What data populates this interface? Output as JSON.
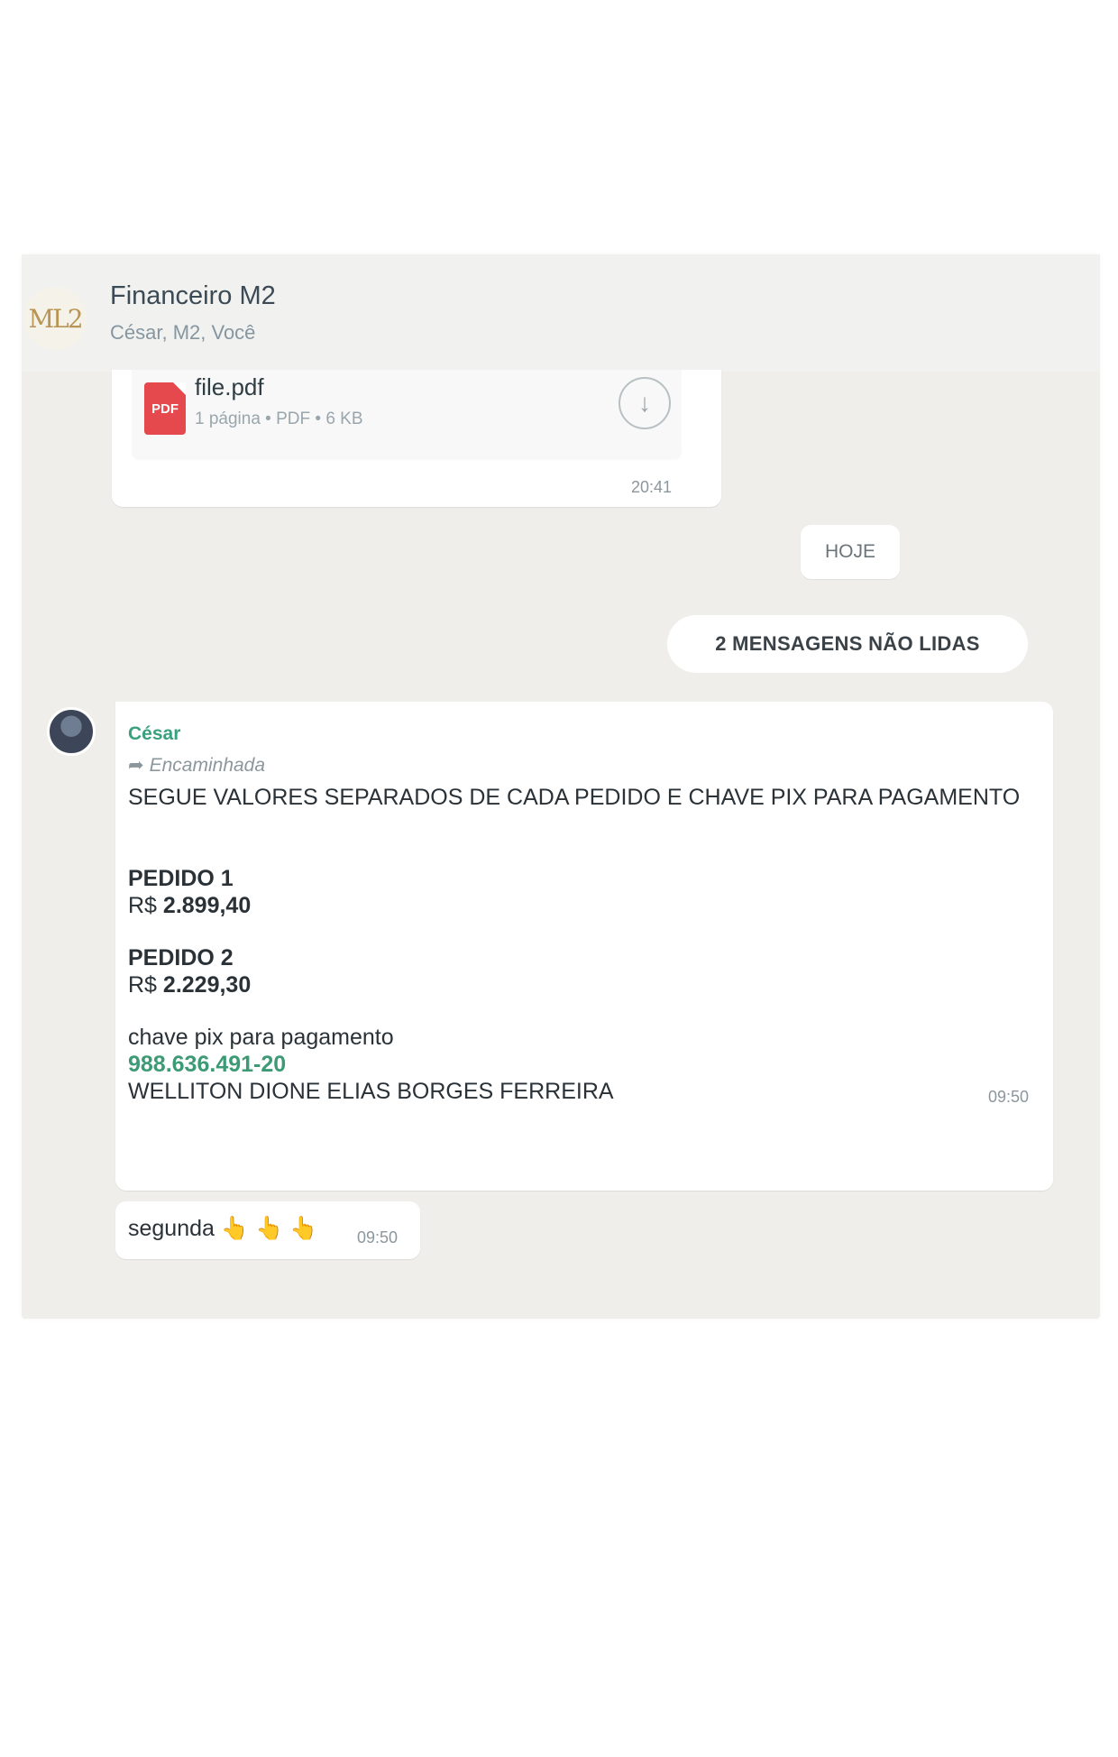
{
  "header": {
    "avatar_text": "ML2",
    "title": "Financeiro M2",
    "members": "César, M2, Você"
  },
  "file_message": {
    "icon_label": "PDF",
    "file_name": "file.pdf",
    "meta": "1 página • PDF • 6 KB",
    "download_icon": "↓",
    "time": "20:41"
  },
  "date_chip": "HOJE",
  "unread_chip": "2 MENSAGENS NÃO LIDAS",
  "forwarded_message": {
    "sender": "César",
    "forwarded_icon": "➦",
    "forwarded_label": "Encaminhada",
    "line1": "SEGUE VALORES SEPARADOS DE CADA PEDIDO E CHAVE PIX PARA PAGAMENTO",
    "pedido1_label": "PEDIDO 1",
    "currency": "R$",
    "pedido1_value": "2.899,40",
    "pedido2_label": "PEDIDO 2",
    "pedido2_value": "2.229,30",
    "pix_label": "chave pix para pagamento",
    "pix_key": "988.636.491-20",
    "pix_name": "WELLITON DIONE ELIAS BORGES FERREIRA",
    "time": "09:50"
  },
  "second_message": {
    "text": "segunda",
    "emoji": "👆 👆 👆",
    "time": "09:50"
  }
}
